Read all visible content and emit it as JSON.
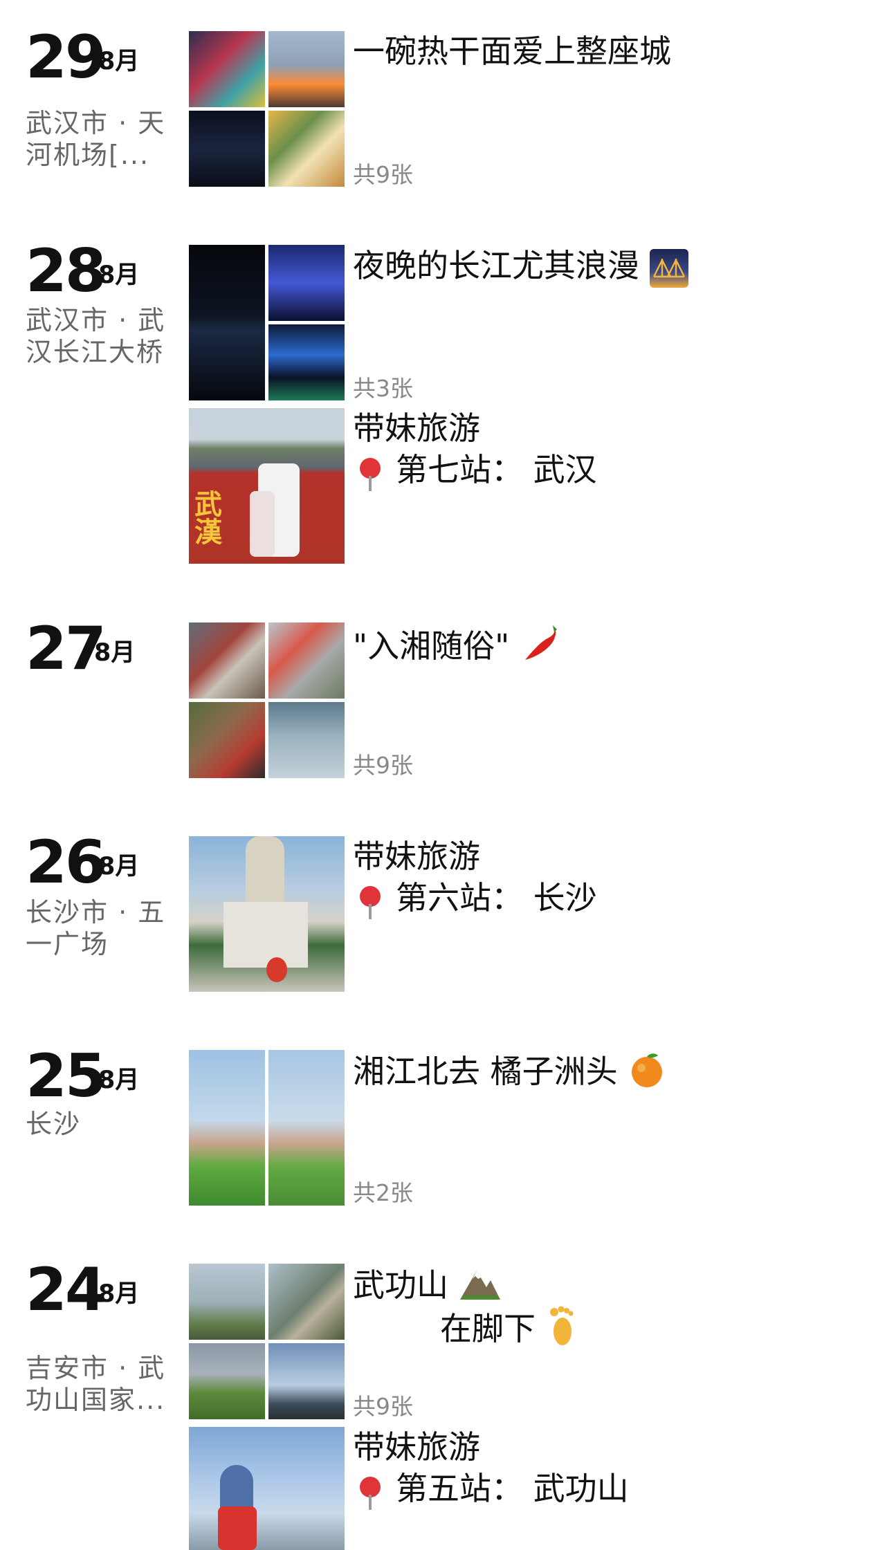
{
  "month_label": "8月",
  "count_prefix": "共",
  "count_suffix": "张",
  "entries": [
    {
      "day": "29",
      "location": "武汉市 · 天河机场[...",
      "posts": [
        {
          "title": "一碗热干面爱上整座城",
          "count": "9"
        }
      ]
    },
    {
      "day": "28",
      "location": "武汉市 · 武汉长江大桥",
      "posts": [
        {
          "title": "夜晚的长江尤其浪漫",
          "emoji": "bridge-night-icon",
          "count": "3"
        },
        {
          "title": "带妹旅游",
          "line2": "第七站：  武汉"
        }
      ]
    },
    {
      "day": "27",
      "location": "",
      "posts": [
        {
          "title": "\"入湘随俗\"",
          "emoji": "chili-pepper-icon",
          "count": "9"
        }
      ]
    },
    {
      "day": "26",
      "location": "长沙市 · 五一广场",
      "posts": [
        {
          "title": "带妹旅游",
          "line2": "第六站：  长沙"
        }
      ]
    },
    {
      "day": "25",
      "location": "长沙",
      "posts": [
        {
          "title": "湘江北去 橘子洲头",
          "emoji": "orange-icon",
          "count": "2"
        }
      ]
    },
    {
      "day": "24",
      "location": "吉安市 · 武功山国家...",
      "posts": [
        {
          "title": "武功山",
          "emoji": "mountain-icon",
          "line2": "在脚下",
          "emoji2": "footprint-icon",
          "count": "9"
        },
        {
          "title": "带妹旅游",
          "line2": "第五站：  武功山"
        }
      ]
    }
  ]
}
